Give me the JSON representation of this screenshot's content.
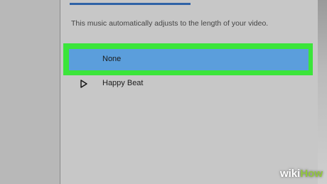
{
  "panel": {
    "info_text": "This music automatically adjusts to the length of your video."
  },
  "options": [
    {
      "label": "None",
      "selected": true
    },
    {
      "label": "Happy Beat",
      "selected": false
    }
  ],
  "watermark": {
    "part1": "wiki",
    "part2": "How"
  },
  "colors": {
    "selected_bg": "#5b9edc",
    "highlight": "#3be53a",
    "accent": "#2f62a6",
    "panel_bg": "#c7c7c7"
  },
  "icons": {
    "play": "play-icon"
  }
}
